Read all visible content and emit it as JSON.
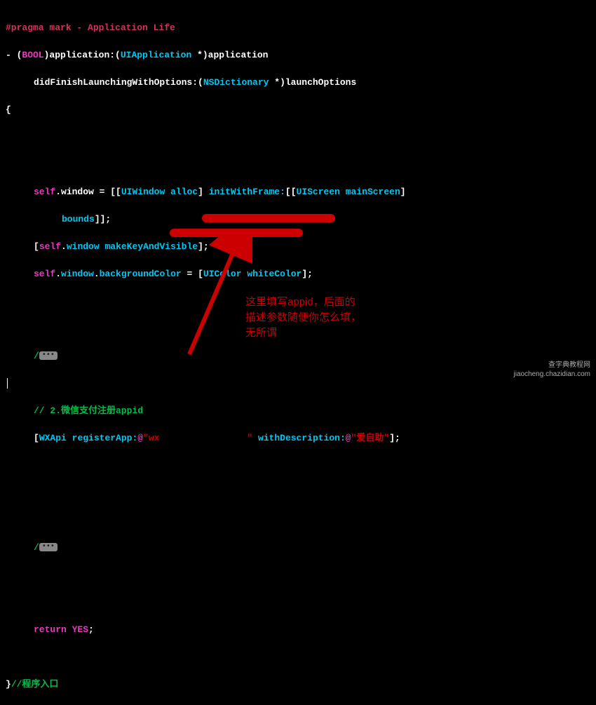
{
  "pragma": "#pragma mark - Application Life",
  "sig1_dash": "- (",
  "sig1_bool": "BOOL",
  "sig1_rest1": ")application:(",
  "sig1_ui": "UIApplication",
  "sig1_rest2": " *)application",
  "sig2_a": "didFinishLaunchingWithOptions:(",
  "sig2_dict": "NSDictionary",
  "sig2_b": " *)launchOptions",
  "brace_open": "{",
  "win_self": "self",
  "win_dot": ".window = [[",
  "win_uiwin": "UIWindow",
  "win_alloc": " alloc",
  "win_close1": "] ",
  "win_init": "initWithFrame:",
  "win_open2": "[[",
  "win_uiscr": "UIScreen",
  "win_main": " mainScreen",
  "win_close2": "]",
  "bounds_txt": "bounds",
  "bounds_end": "]];",
  "mkv_open": "[",
  "mkv_self": "self",
  "mkv_dot": ".",
  "mkv_window": "window",
  "mkv_sp": " ",
  "mkv_method": "makeKeyAndVisible",
  "mkv_end": "];",
  "bg_self": "self",
  "bg_dot1": ".",
  "bg_window": "window",
  "bg_dot2": ".",
  "bg_color": "backgroundColor",
  "bg_eq": " = [",
  "bg_uicolor": "UIColor",
  "bg_white": " whiteColor",
  "bg_end": "];",
  "fold_slash": "/",
  "fold_dots": "•••",
  "comment_wx": "// 2.微信支付注册appid ",
  "wx_open": "[",
  "wx_api": "WXApi",
  "wx_sp": " ",
  "wx_reg": "registerApp:",
  "wx_at1": "@",
  "wx_str1a": "\"wx",
  "wx_str1b": "\"",
  "wx_sp2": " ",
  "wx_desc": "withDescription:",
  "wx_at2": "@",
  "wx_str2": "\"爱自助\"",
  "wx_end": "];",
  "return_kw": "return",
  "return_sp": " ",
  "return_yes": "YES",
  "return_end": ";",
  "brace_close": "}",
  "comment_entry": "//程序入口",
  "annotation_text": "这里填写appid，后面的\n描述参数随便你怎么填，\n无所谓",
  "watermark_line1": "查字典教程网",
  "watermark_line2": "jiaocheng.chazidian.com"
}
